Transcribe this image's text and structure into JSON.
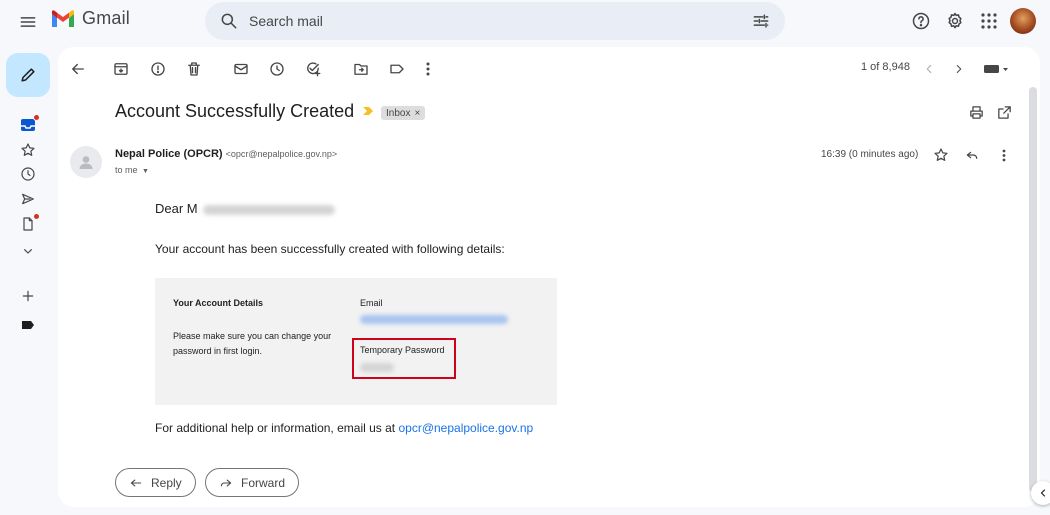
{
  "app": {
    "name": "Gmail"
  },
  "search": {
    "placeholder": "Search mail"
  },
  "toolbar": {
    "pager_text": "1 of 8,948"
  },
  "email": {
    "subject": "Account Successfully Created",
    "label": "Inbox",
    "label_close": "×",
    "sender_name": "Nepal Police (OPCR)",
    "sender_email": "<opcr@nepalpolice.gov.np>",
    "recipient": "to me",
    "time": "16:39 (0 minutes ago)",
    "greeting": "Dear M",
    "intro": "Your account has been successfully created with following details:",
    "details": {
      "heading": "Your Account Details",
      "note_line1": "Please make sure you can change your",
      "note_line2": "password in first login.",
      "email_label": "Email",
      "password_label": "Temporary Password"
    },
    "help_text": "For additional help or information, email us at ",
    "help_email": "opcr@nepalpolice.gov.np"
  },
  "actions": {
    "reply": "Reply",
    "forward": "Forward"
  },
  "colors": {
    "background": "#f6f8fc",
    "compose": "#c2e7ff",
    "search_bg": "#e9eef6",
    "link": "#1a73e8",
    "highlight": "#d0021b",
    "important": "#f6bf26"
  }
}
